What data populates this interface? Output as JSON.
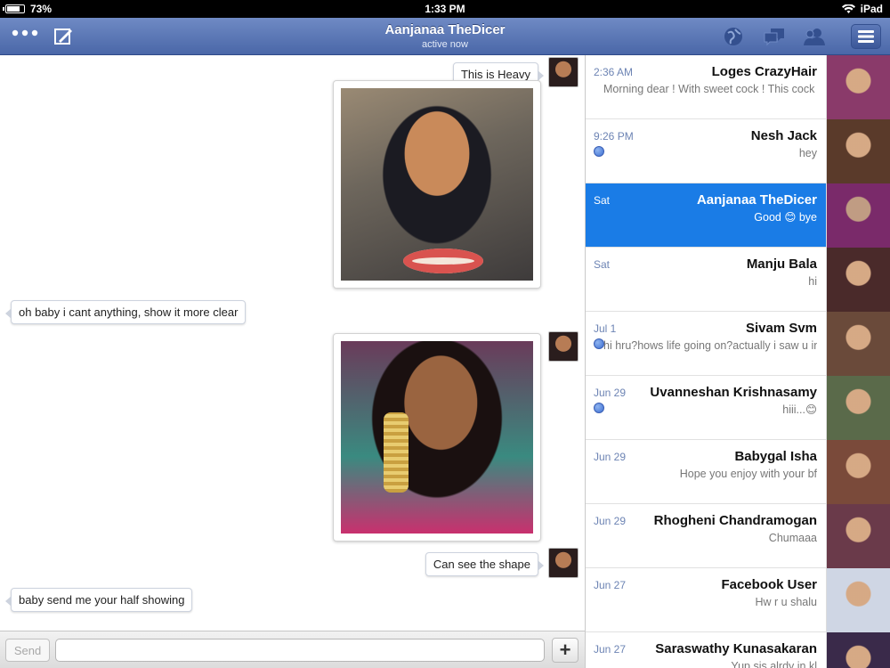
{
  "status_bar": {
    "battery": "73%",
    "time": "1:33 PM",
    "device": "iPad"
  },
  "header": {
    "title": "Aanjanaa TheDicer",
    "subtitle": "active now"
  },
  "messages": [
    {
      "text": "This is Heavy",
      "from": "me"
    },
    {
      "text": "oh baby i cant anything, show it more clear",
      "from": "them"
    },
    {
      "text": "Can see the shape",
      "from": "me"
    },
    {
      "text": "baby send me your half showing",
      "from": "them"
    }
  ],
  "composer": {
    "send_label": "Send",
    "placeholder": "",
    "value": "",
    "plus_label": "+"
  },
  "conversations": [
    {
      "name": "Loges CrazyHair",
      "time": "2:36 AM",
      "preview": "Morning dear ! With sweet cock ! This cock make me so wet ! Smoot...",
      "active": false,
      "unread": false,
      "avatar_color": "#8a3a6a"
    },
    {
      "name": "Nesh Jack",
      "time": "9:26 PM",
      "preview": "hey",
      "active": false,
      "unread": true,
      "avatar_color": "#5a3a2a"
    },
    {
      "name": "Aanjanaa TheDicer",
      "time": "Sat",
      "preview": "Good 😊 bye",
      "active": true,
      "unread": false,
      "avatar_color": "#7a2a6a"
    },
    {
      "name": "Manju Bala",
      "time": "Sat",
      "preview": "hi",
      "active": false,
      "unread": false,
      "avatar_color": "#4a2a2a"
    },
    {
      "name": "Sivam Svm",
      "time": "Jul 1",
      "preview": "hi hru?hows life going on?actually i saw u in frd suggestion.so i msg u...",
      "active": false,
      "unread": true,
      "avatar_color": "#6a4a3a"
    },
    {
      "name": "Uvanneshan Krishnasamy",
      "time": "Jun 29",
      "preview": "hiii...😊",
      "active": false,
      "unread": true,
      "avatar_color": "#5a6a4a"
    },
    {
      "name": "Babygal Isha",
      "time": "Jun 29",
      "preview": "Hope you enjoy with your bf",
      "active": false,
      "unread": false,
      "avatar_color": "#7a4a3a"
    },
    {
      "name": "Rhogheni Chandramogan",
      "time": "Jun 29",
      "preview": "Chumaaa",
      "active": false,
      "unread": false,
      "avatar_color": "#6a3a4a"
    },
    {
      "name": "Facebook User",
      "time": "Jun 27",
      "preview": "Hw r u shalu",
      "active": false,
      "unread": false,
      "avatar_color": "#cfd6e4"
    },
    {
      "name": "Saraswathy Kunasakaran",
      "time": "Jun 27",
      "preview": "Yup sis alrdy in kl",
      "active": false,
      "unread": false,
      "avatar_color": "#3a2a4a"
    }
  ]
}
